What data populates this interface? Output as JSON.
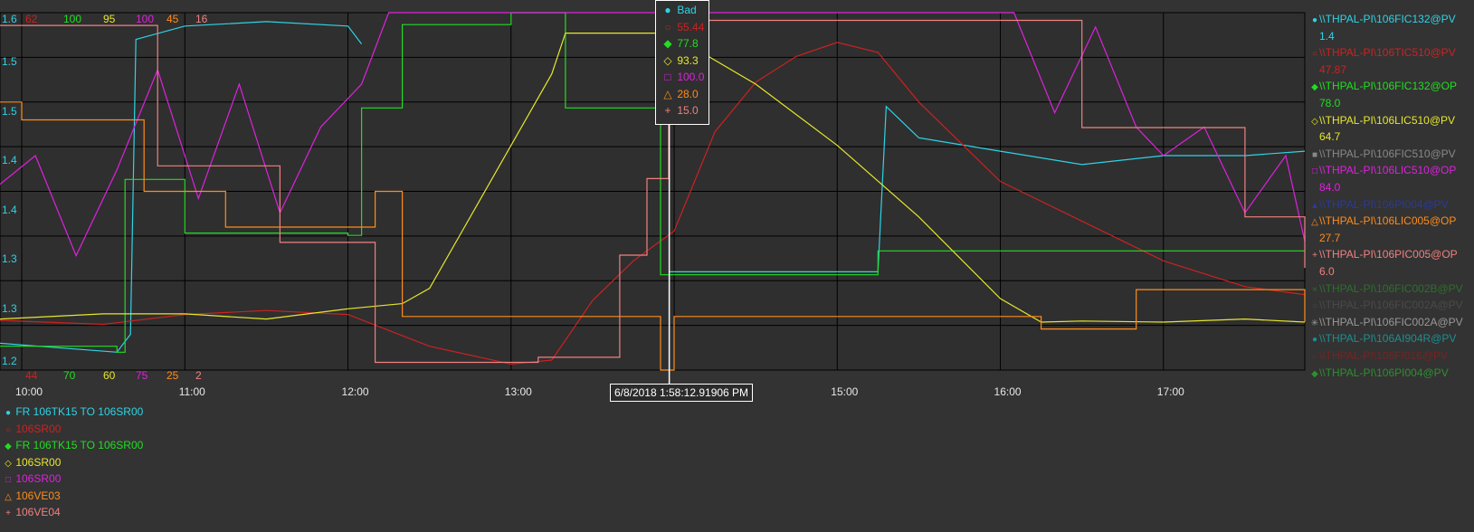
{
  "chart_data": {
    "type": "line",
    "x_ticks": [
      "10:00",
      "11:00",
      "12:00",
      "13:00",
      "14:00",
      "15:00",
      "16:00",
      "17:00"
    ],
    "y_ticks": [
      "1.6",
      "1.5",
      "1.5",
      "1.4",
      "1.4",
      "1.3",
      "1.3",
      "1.2"
    ],
    "scale_max": [
      "62",
      "100",
      "95",
      "100",
      "45",
      "16"
    ],
    "scale_min": [
      "44",
      "70",
      "60",
      "75",
      "25",
      "2"
    ],
    "scale_colors": [
      "#cc2222",
      "#22dd22",
      "#e6e62e",
      "#dd22dd",
      "#ff8c1a",
      "#f08080"
    ],
    "cursor_time": "6/8/2018 1:58:12.91906 PM",
    "grid": true,
    "series": [
      {
        "name": "\\\\THPAL-PI\\106FIC132@PV",
        "color": "#2ed3e6",
        "x": [
          "9:52",
          "10:35",
          "10:40",
          "10:42",
          "11:00",
          "11:30",
          "12:00",
          "12:05",
          "12:10",
          "13:00",
          "13:30",
          "13:55",
          "13:58",
          "14:30",
          "15:00",
          "15:15",
          "15:18",
          "15:30",
          "16:00",
          "16:30",
          "17:00",
          "17:30",
          "17:52"
        ],
        "values": [
          1.23,
          1.22,
          1.24,
          1.57,
          1.585,
          1.59,
          1.585,
          1.565,
          null,
          null,
          null,
          null,
          1.31,
          1.31,
          1.31,
          1.31,
          1.495,
          1.46,
          1.445,
          1.43,
          1.44,
          1.44,
          1.445
        ]
      },
      {
        "name": "\\\\THPAL-PI\\106TIC510@PV",
        "color": "#cc2222",
        "x": [
          "9:52",
          "10:30",
          "11:00",
          "11:30",
          "12:00",
          "12:30",
          "13:00",
          "13:15",
          "13:30",
          "13:45",
          "14:00",
          "14:15",
          "14:30",
          "14:45",
          "15:00",
          "15:15",
          "15:30",
          "16:00",
          "16:30",
          "17:00",
          "17:30",
          "17:52"
        ],
        "values": [
          46.5,
          46.3,
          46.8,
          47.0,
          46.8,
          45.2,
          44.3,
          44.5,
          47.5,
          49.5,
          51.0,
          56.0,
          58.5,
          59.8,
          60.5,
          60.0,
          57.5,
          53.5,
          51.5,
          49.5,
          48.2,
          47.8
        ]
      },
      {
        "name": "\\\\THPAL-PI\\106FIC132@OP",
        "color": "#22dd22",
        "x": [
          "9:52",
          "10:35",
          "10:38",
          "11:00",
          "12:00",
          "12:05",
          "12:10",
          "12:20",
          "13:00",
          "13:15",
          "13:20",
          "13:50",
          "13:55",
          "14:30",
          "15:10",
          "15:15",
          "16:00",
          "16:30",
          "17:00",
          "17:52"
        ],
        "values": [
          72,
          71.5,
          86,
          81.5,
          81.3,
          92,
          92,
          99,
          100,
          100,
          92,
          92,
          78,
          78,
          78,
          80,
          80,
          80,
          80,
          80
        ]
      },
      {
        "name": "\\\\THPAL-PI\\106LIC510@PV",
        "color": "#e6e62e",
        "x": [
          "9:52",
          "10:30",
          "11:00",
          "11:30",
          "12:00",
          "12:20",
          "12:30",
          "13:00",
          "13:15",
          "13:20",
          "13:40",
          "13:58",
          "14:30",
          "15:00",
          "15:30",
          "16:00",
          "16:15",
          "16:30",
          "17:00",
          "17:30",
          "17:52"
        ],
        "values": [
          65,
          65.5,
          65.5,
          65,
          66,
          66.5,
          68,
          82,
          89,
          93,
          93,
          93,
          88,
          82,
          75,
          67,
          64.7,
          64.8,
          64.7,
          65,
          64.7
        ]
      },
      {
        "name": "\\\\THPAL-PI\\106LIC510@OP",
        "color": "#dd22dd",
        "x": [
          "9:52",
          "10:05",
          "10:20",
          "10:35",
          "10:50",
          "11:05",
          "11:20",
          "11:35",
          "11:50",
          "12:05",
          "12:15",
          "14:30",
          "16:05",
          "16:20",
          "16:35",
          "16:50",
          "17:00",
          "17:15",
          "17:30",
          "17:45",
          "17:52"
        ],
        "values": [
          88,
          90,
          83,
          89,
          96,
          87,
          95,
          86,
          92,
          95,
          100,
          100,
          100,
          93,
          99,
          92,
          90,
          92,
          86,
          90,
          84
        ]
      },
      {
        "name": "\\\\THPAL-PI\\106LIC005@OP",
        "color": "#ff8c1a",
        "x": [
          "9:52",
          "10:00",
          "10:45",
          "11:15",
          "12:00",
          "12:10",
          "12:20",
          "13:00",
          "13:30",
          "13:55",
          "14:00",
          "14:30",
          "15:00",
          "16:00",
          "16:15",
          "16:30",
          "16:50",
          "17:00",
          "17:30",
          "17:52"
        ],
        "values": [
          40,
          39,
          35,
          33,
          33,
          35,
          28,
          28,
          28,
          25,
          28,
          28,
          28,
          28,
          27.3,
          27.3,
          29.5,
          29.5,
          29.5,
          27.7
        ]
      },
      {
        "name": "\\\\THPAL-PI\\106PIC005@OP",
        "color": "#f08080",
        "x": [
          "9:52",
          "10:00",
          "10:50",
          "11:20",
          "11:35",
          "12:00",
          "12:10",
          "12:30",
          "13:10",
          "13:40",
          "13:50",
          "13:58",
          "14:30",
          "15:00",
          "15:30",
          "16:00",
          "16:25",
          "16:30",
          "17:00",
          "17:30",
          "17:52"
        ],
        "values": [
          15.5,
          15.5,
          10,
          10,
          7,
          7,
          2.3,
          2.3,
          2.5,
          6.5,
          9.5,
          15.7,
          15.7,
          15.7,
          15.7,
          15.7,
          15.7,
          11.5,
          11.5,
          8,
          6
        ]
      }
    ]
  },
  "tooltip": {
    "rows": [
      {
        "sym": "●",
        "text": "Bad",
        "color": "#2ed3e6"
      },
      {
        "sym": "○",
        "text": "55.44",
        "color": "#cc2222"
      },
      {
        "sym": "◆",
        "text": "77.8",
        "color": "#22dd22"
      },
      {
        "sym": "◇",
        "text": "93.3",
        "color": "#e6e62e"
      },
      {
        "sym": "□",
        "text": "100.0",
        "color": "#dd22dd"
      },
      {
        "sym": "△",
        "text": "28.0",
        "color": "#ff8c1a"
      },
      {
        "sym": "+",
        "text": "15.0",
        "color": "#f08080"
      }
    ]
  },
  "legend_right": [
    {
      "sym": "●",
      "name": "\\\\THPAL-PI\\106FIC132@PV",
      "value": "1.4",
      "color": "#2ed3e6"
    },
    {
      "sym": "○",
      "name": "\\\\THPAL-PI\\106TIC510@PV",
      "value": "47.87",
      "color": "#cc2222"
    },
    {
      "sym": "◆",
      "name": "\\\\THPAL-PI\\106FIC132@OP",
      "value": "78.0",
      "color": "#22dd22"
    },
    {
      "sym": "◇",
      "name": "\\\\THPAL-PI\\106LIC510@PV",
      "value": "64.7",
      "color": "#e6e62e"
    },
    {
      "sym": "■",
      "name": "\\\\THPAL-PI\\106FIC510@PV",
      "value": "",
      "color": "#888888"
    },
    {
      "sym": "□",
      "name": "\\\\THPAL-PI\\106LIC510@OP",
      "value": "84.0",
      "color": "#dd22dd"
    },
    {
      "sym": "▲",
      "name": "\\\\THPAL-PI\\106PI004@PV",
      "value": "",
      "color": "#2a3a9a"
    },
    {
      "sym": "△",
      "name": "\\\\THPAL-PI\\106LIC005@OP",
      "value": "27.7",
      "color": "#ff8c1a"
    },
    {
      "sym": "+",
      "name": "\\\\THPAL-PI\\106PIC005@OP",
      "value": "6.0",
      "color": "#f08080"
    },
    {
      "sym": "×",
      "name": "\\\\THPAL-PI\\106FIC002B@PV",
      "value": "",
      "color": "#2e6e2e"
    },
    {
      "sym": "○",
      "name": "\\\\THPAL-PI\\106FIC002A@PV",
      "value": "",
      "color": "#4a4a4a"
    },
    {
      "sym": "✳",
      "name": "\\\\THPAL-PI\\106FIC002A@PV",
      "value": "",
      "color": "#999999"
    },
    {
      "sym": "●",
      "name": "\\\\THPAL-PI\\106AI904R@PV",
      "value": "",
      "color": "#1e8f8f"
    },
    {
      "sym": "○",
      "name": "\\\\THPAL-PI\\106FI016@PV",
      "value": "",
      "color": "#7a2222"
    },
    {
      "sym": "◆",
      "name": "\\\\THPAL-PI\\106PI004@PV",
      "value": "",
      "color": "#2e8f2e"
    }
  ],
  "legend_bottom": [
    {
      "sym": "●",
      "text": "FR 106TK15  TO 106SR00",
      "color": "#2ed3e6"
    },
    {
      "sym": "○",
      "text": "106SR00",
      "color": "#cc2222"
    },
    {
      "sym": "◆",
      "text": "FR 106TK15  TO 106SR00",
      "color": "#22dd22"
    },
    {
      "sym": "◇",
      "text": "106SR00",
      "color": "#e6e62e"
    },
    {
      "sym": "□",
      "text": "106SR00",
      "color": "#dd22dd"
    },
    {
      "sym": "△",
      "text": "106VE03",
      "color": "#ff8c1a"
    },
    {
      "sym": "+",
      "text": "106VE04",
      "color": "#f08080"
    }
  ]
}
